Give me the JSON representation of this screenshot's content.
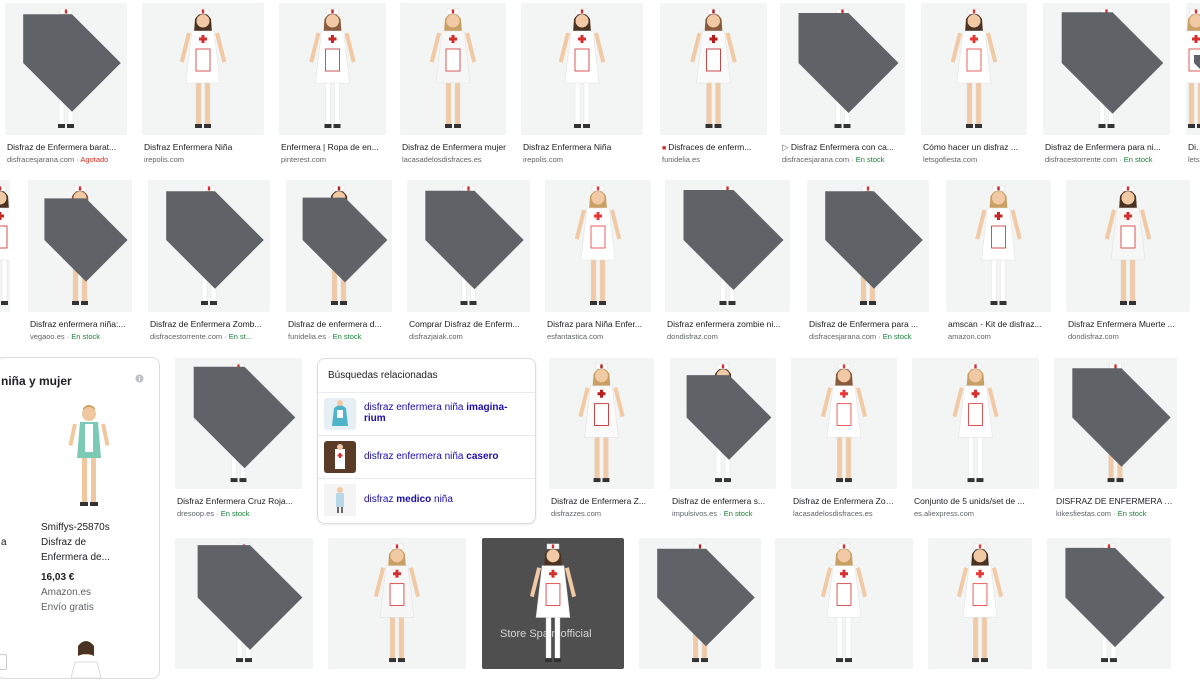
{
  "rows": [
    [
      {
        "caption": "Disfraz de Enfermera barat...",
        "source": "disfracesjarana.com",
        "status": "Agotado",
        "status_type": "out",
        "tag": true,
        "badge": ""
      },
      {
        "caption": "Disfraz Enfermera Niña",
        "source": "irepolis.com",
        "status": "",
        "status_type": "",
        "tag": false,
        "badge": ""
      },
      {
        "caption": "Enfermera | Ropa de en...",
        "source": "pinterest.com",
        "status": "",
        "status_type": "",
        "tag": false,
        "badge": ""
      },
      {
        "caption": "Disfraz de Enfermera mujer",
        "source": "lacasadelosdisfraces.es",
        "status": "",
        "status_type": "",
        "tag": false,
        "badge": ""
      },
      {
        "caption": "Disfraz Enfermera Niña",
        "source": "irepolis.com",
        "status": "",
        "status_type": "",
        "tag": false,
        "badge": ""
      },
      {
        "caption": "Disfraces de enferm...",
        "source": "funidelia.es",
        "status": "",
        "status_type": "",
        "tag": false,
        "badge": "truck"
      },
      {
        "caption": "Disfraz Enfermera con ca...",
        "source": "disfracesjarana.com",
        "status": "En stock",
        "status_type": "stock",
        "tag": true,
        "badge": "play"
      },
      {
        "caption": "Cómo hacer un disfraz ...",
        "source": "letsgofiesta.com",
        "status": "",
        "status_type": "",
        "tag": false,
        "badge": ""
      },
      {
        "caption": "Disfraz de Enfermera para ni...",
        "source": "disfracestorrente.com",
        "status": "En stock",
        "status_type": "stock",
        "tag": true,
        "badge": ""
      },
      {
        "caption": "Dis...",
        "source": "lets...",
        "status": "",
        "status_type": "",
        "tag": true,
        "badge": ""
      }
    ],
    [
      {
        "caption": "...",
        "source": "...",
        "status": "",
        "status_type": "",
        "tag": false,
        "badge": ""
      },
      {
        "caption": "Disfraz enfermera niña:...",
        "source": "vegaoo.es",
        "status": "En stock",
        "status_type": "stock",
        "tag": true,
        "badge": ""
      },
      {
        "caption": "Disfraz de Enfermera Zomb...",
        "source": "disfracestorrente.com",
        "status": "En st...",
        "status_type": "stock",
        "tag": true,
        "badge": ""
      },
      {
        "caption": "Disfraz de enfermera d...",
        "source": "funidelia.es",
        "status": "En stock",
        "status_type": "stock",
        "tag": true,
        "badge": ""
      },
      {
        "caption": "Comprar Disfraz de Enferm...",
        "source": "disfrazjaiak.com",
        "status": "",
        "status_type": "",
        "tag": true,
        "badge": ""
      },
      {
        "caption": "Disfraz para Niña Enfer...",
        "source": "esfantastica.com",
        "status": "",
        "status_type": "",
        "tag": false,
        "badge": ""
      },
      {
        "caption": "Disfraz enfermera zombie ni...",
        "source": "dondisfraz.com",
        "status": "",
        "status_type": "",
        "tag": true,
        "badge": ""
      },
      {
        "caption": "Disfraz de Enfermera para ...",
        "source": "disfracesjarana.com",
        "status": "En stock",
        "status_type": "stock",
        "tag": true,
        "badge": ""
      },
      {
        "caption": "amscan - Kit de disfraz...",
        "source": "amazon.com",
        "status": "",
        "status_type": "",
        "tag": false,
        "badge": ""
      },
      {
        "caption": "Disfraz Enfermera Muerte ...",
        "source": "dondisfraz.com",
        "status": "",
        "status_type": "",
        "tag": false,
        "badge": ""
      }
    ],
    [
      {
        "caption": "Disfraz Enfermera Cruz Roja...",
        "source": "dresoop.es",
        "status": "En stock",
        "status_type": "stock",
        "tag": true,
        "badge": ""
      },
      {
        "caption": "Disfraz de Enfermera Z...",
        "source": "disfrazzes.com",
        "status": "",
        "status_type": "",
        "tag": false,
        "badge": ""
      },
      {
        "caption": "Disfraz de enfermera s...",
        "source": "impulsivos.es",
        "status": "En stock",
        "status_type": "stock",
        "tag": true,
        "badge": ""
      },
      {
        "caption": "Disfraz de Enfermera Zom...",
        "source": "lacasadelosdisfraces.es",
        "status": "",
        "status_type": "",
        "tag": false,
        "badge": ""
      },
      {
        "caption": "Conjunto de 5 unids/set de ...",
        "source": "es.aliexpress.com",
        "status": "",
        "status_type": "",
        "tag": false,
        "badge": ""
      },
      {
        "caption": "DISFRAZ DE ENFERMERA NI...",
        "source": "kikesfiestas.com",
        "status": "En stock",
        "status_type": "stock",
        "tag": true,
        "badge": ""
      }
    ],
    [
      {
        "caption": "",
        "source": "",
        "status": "",
        "status_type": "",
        "tag": true,
        "badge": ""
      },
      {
        "caption": "",
        "source": "",
        "status": "",
        "status_type": "",
        "tag": false,
        "badge": ""
      },
      {
        "caption": "",
        "source": "",
        "status": "",
        "status_type": "",
        "tag": false,
        "badge": "",
        "overlay": "Store Spain official"
      },
      {
        "caption": "",
        "source": "",
        "status": "",
        "status_type": "",
        "tag": true,
        "badge": ""
      },
      {
        "caption": "",
        "source": "",
        "status": "",
        "status_type": "",
        "tag": false,
        "badge": ""
      },
      {
        "caption": "",
        "source": "",
        "status": "",
        "status_type": "",
        "tag": false,
        "badge": ""
      },
      {
        "caption": "",
        "source": "",
        "status": "",
        "status_type": "",
        "tag": true,
        "badge": ""
      }
    ]
  ],
  "related": {
    "title": "Búsquedas relacionadas",
    "items": [
      {
        "pre": "disfraz enfermera niña ",
        "bold": "imagina-rium",
        "post": ""
      },
      {
        "pre": "disfraz enfermera niña ",
        "bold": "casero",
        "post": ""
      },
      {
        "pre": "disfraz ",
        "bold": "medico",
        "post": " niña"
      }
    ]
  },
  "shopping": {
    "title": "niña y mujer",
    "product": "Smiffys-25870s Disfraz de Enfermera de...",
    "product_line1": "Smiffys-25870s",
    "product_line2": "Disfraz de",
    "product_line3": "Enfermera de...",
    "price": "16,03 €",
    "store": "Amazon.es",
    "shipping": "Envío gratis",
    "left_fragment": "a"
  },
  "colors": {
    "accent_red": "#d32f2f",
    "link": "#1a0dab",
    "stock": "#188038",
    "out": "#d93025",
    "muted": "#5f6368"
  }
}
